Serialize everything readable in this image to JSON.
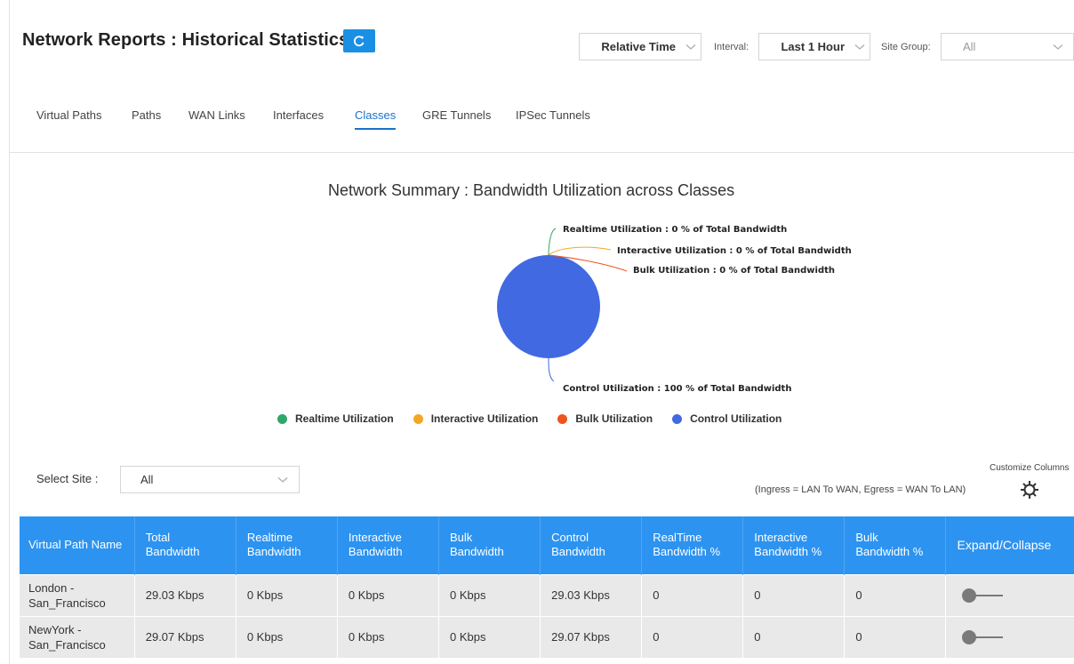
{
  "header": {
    "title": "Network Reports : Historical Statistics",
    "time_mode": "Relative Time",
    "interval_label": "Interval:",
    "interval_value": "Last 1 Hour",
    "site_group_label": "Site Group:",
    "site_group_value": "All"
  },
  "tabs": [
    {
      "label": "Virtual Paths",
      "active": false
    },
    {
      "label": "Paths",
      "active": false
    },
    {
      "label": "WAN Links",
      "active": false
    },
    {
      "label": "Interfaces",
      "active": false
    },
    {
      "label": "Classes",
      "active": true
    },
    {
      "label": "GRE Tunnels",
      "active": false
    },
    {
      "label": "IPSec Tunnels",
      "active": false
    }
  ],
  "chart_data": {
    "type": "pie",
    "title": "Network Summary : Bandwidth Utilization across Classes",
    "categories": [
      "Realtime Utilization",
      "Interactive Utilization",
      "Bulk Utilization",
      "Control Utilization"
    ],
    "values": [
      0,
      0,
      0,
      100
    ],
    "colors": [
      "#2ea86a",
      "#f5a623",
      "#f0531c",
      "#4169e1"
    ],
    "data_labels": [
      "Realtime Utilization : 0 % of Total Bandwidth",
      "Interactive Utilization : 0 % of Total Bandwidth",
      "Bulk Utilization : 0 % of Total Bandwidth",
      "Control Utilization : 100 % of Total Bandwidth"
    ],
    "legend_position": "bottom"
  },
  "filters": {
    "select_site_label": "Select Site :",
    "select_site_value": "All",
    "note": "(Ingress = LAN To WAN, Egress = WAN To LAN)",
    "customize_label": "Customize Columns"
  },
  "table": {
    "columns": [
      [
        "Virtual Path Name"
      ],
      [
        "Total",
        "Bandwidth"
      ],
      [
        "Realtime",
        "Bandwidth"
      ],
      [
        "Interactive",
        "Bandwidth"
      ],
      [
        "Bulk",
        "Bandwidth"
      ],
      [
        "Control",
        "Bandwidth"
      ],
      [
        "RealTime",
        "Bandwidth %"
      ],
      [
        "Interactive",
        "Bandwidth %"
      ],
      [
        "Bulk",
        "Bandwidth %"
      ],
      [
        "Expand/Collapse"
      ]
    ],
    "rows": [
      {
        "name": [
          "London -",
          "San_Francisco"
        ],
        "total": "29.03 Kbps",
        "realtime": "0 Kbps",
        "interactive": "0 Kbps",
        "bulk": "0 Kbps",
        "control": "29.03 Kbps",
        "realtime_pct": "0",
        "interactive_pct": "0",
        "bulk_pct": "0"
      },
      {
        "name": [
          "NewYork -",
          "San_Francisco"
        ],
        "total": "29.07 Kbps",
        "realtime": "0 Kbps",
        "interactive": "0 Kbps",
        "bulk": "0 Kbps",
        "control": "29.07 Kbps",
        "realtime_pct": "0",
        "interactive_pct": "0",
        "bulk_pct": "0"
      }
    ]
  },
  "icons": {
    "refresh": "refresh-icon",
    "chevron": "chevron-down-icon",
    "gear": "gear-icon",
    "toggle": "toggle-switch-icon"
  }
}
